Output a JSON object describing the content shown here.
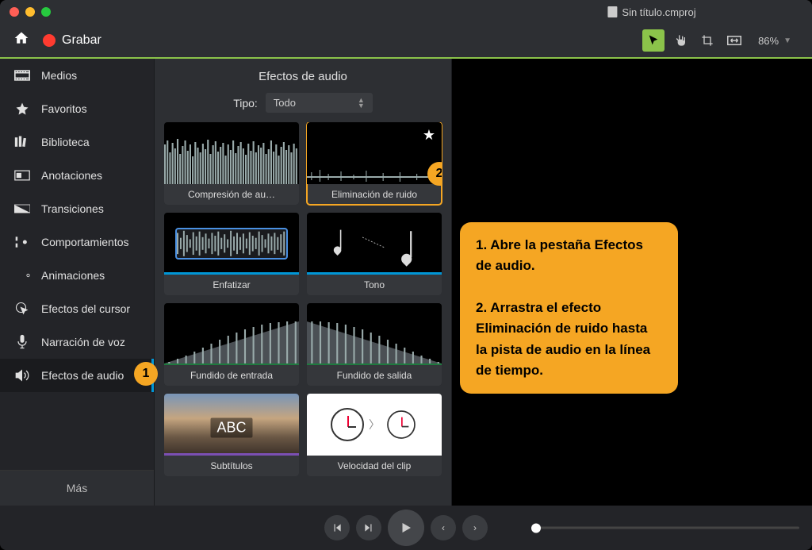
{
  "titlebar": {
    "document": "Sin título.cmproj"
  },
  "toolbar": {
    "record_label": "Grabar",
    "zoom": "86%"
  },
  "sidebar": {
    "items": [
      {
        "label": "Medios"
      },
      {
        "label": "Favoritos"
      },
      {
        "label": "Biblioteca"
      },
      {
        "label": "Anotaciones"
      },
      {
        "label": "Transiciones"
      },
      {
        "label": "Comportamientos"
      },
      {
        "label": "Animaciones"
      },
      {
        "label": "Efectos del cursor"
      },
      {
        "label": "Narración de voz"
      },
      {
        "label": "Efectos de audio"
      }
    ],
    "more_label": "Más"
  },
  "panel": {
    "title": "Efectos de audio",
    "type_label": "Tipo:",
    "type_value": "Todo",
    "effects": [
      {
        "label": "Compresión de au…"
      },
      {
        "label": "Eliminación de ruido"
      },
      {
        "label": "Enfatizar"
      },
      {
        "label": "Tono"
      },
      {
        "label": "Fundido de entrada"
      },
      {
        "label": "Fundido de salida"
      },
      {
        "label": "Subtítulos"
      },
      {
        "label": "Velocidad del clip"
      }
    ]
  },
  "badges": {
    "one": "1",
    "two": "2"
  },
  "callout": {
    "line1": "1. Abre la pestaña Efectos de audio.",
    "line2": "2. Arrastra el efecto Eliminación de ruido hasta la pista de audio en la línea de tiempo."
  },
  "subtitle_thumb": "ABC"
}
